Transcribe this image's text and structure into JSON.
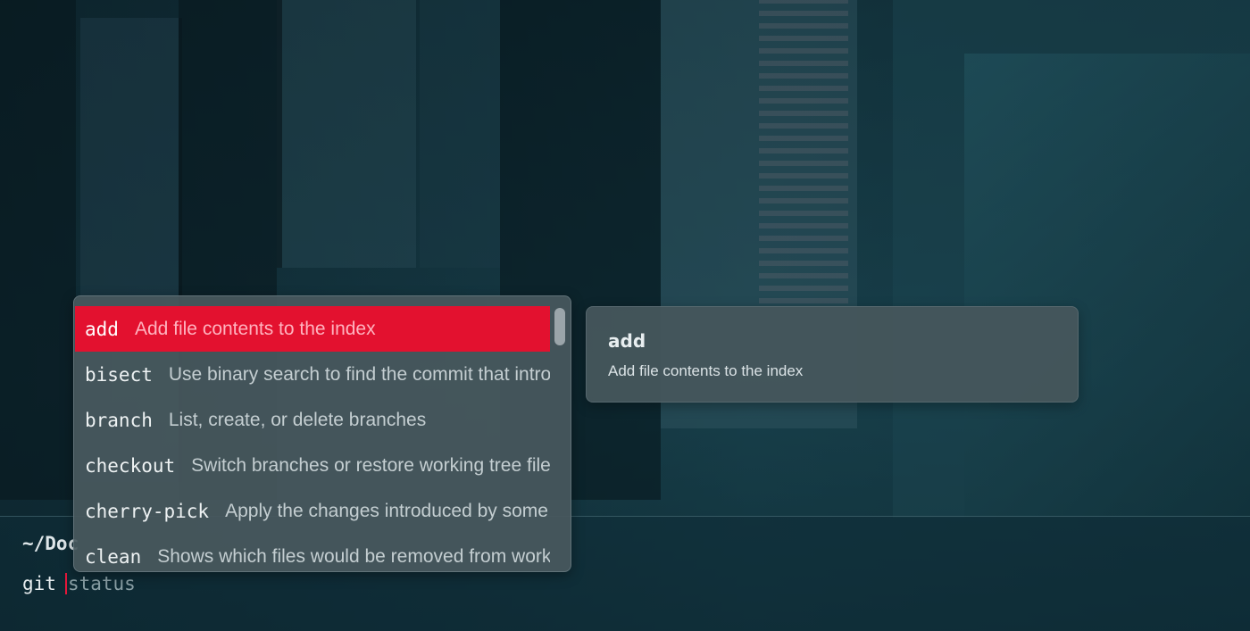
{
  "prompt": {
    "path": "~/Doc"
  },
  "command_line": {
    "command": "git",
    "suggestion": "status"
  },
  "completion_menu": {
    "items": [
      {
        "name": "add",
        "description": "Add file contents to the index"
      },
      {
        "name": "bisect",
        "description": "Use binary search to find the commit that introduced a bug"
      },
      {
        "name": "branch",
        "description": "List, create, or delete branches"
      },
      {
        "name": "checkout",
        "description": "Switch branches or restore working tree files"
      },
      {
        "name": "cherry-pick",
        "description": "Apply the changes introduced by some existing commits"
      },
      {
        "name": "clean",
        "description": "Shows which files would be removed from working directory"
      }
    ],
    "selected_index": 0
  },
  "detail_panel": {
    "title": "add",
    "description": "Add file contents to the index"
  },
  "colors": {
    "selection": "#e3112f",
    "cursor": "#e5173a",
    "background": "#163a44"
  }
}
